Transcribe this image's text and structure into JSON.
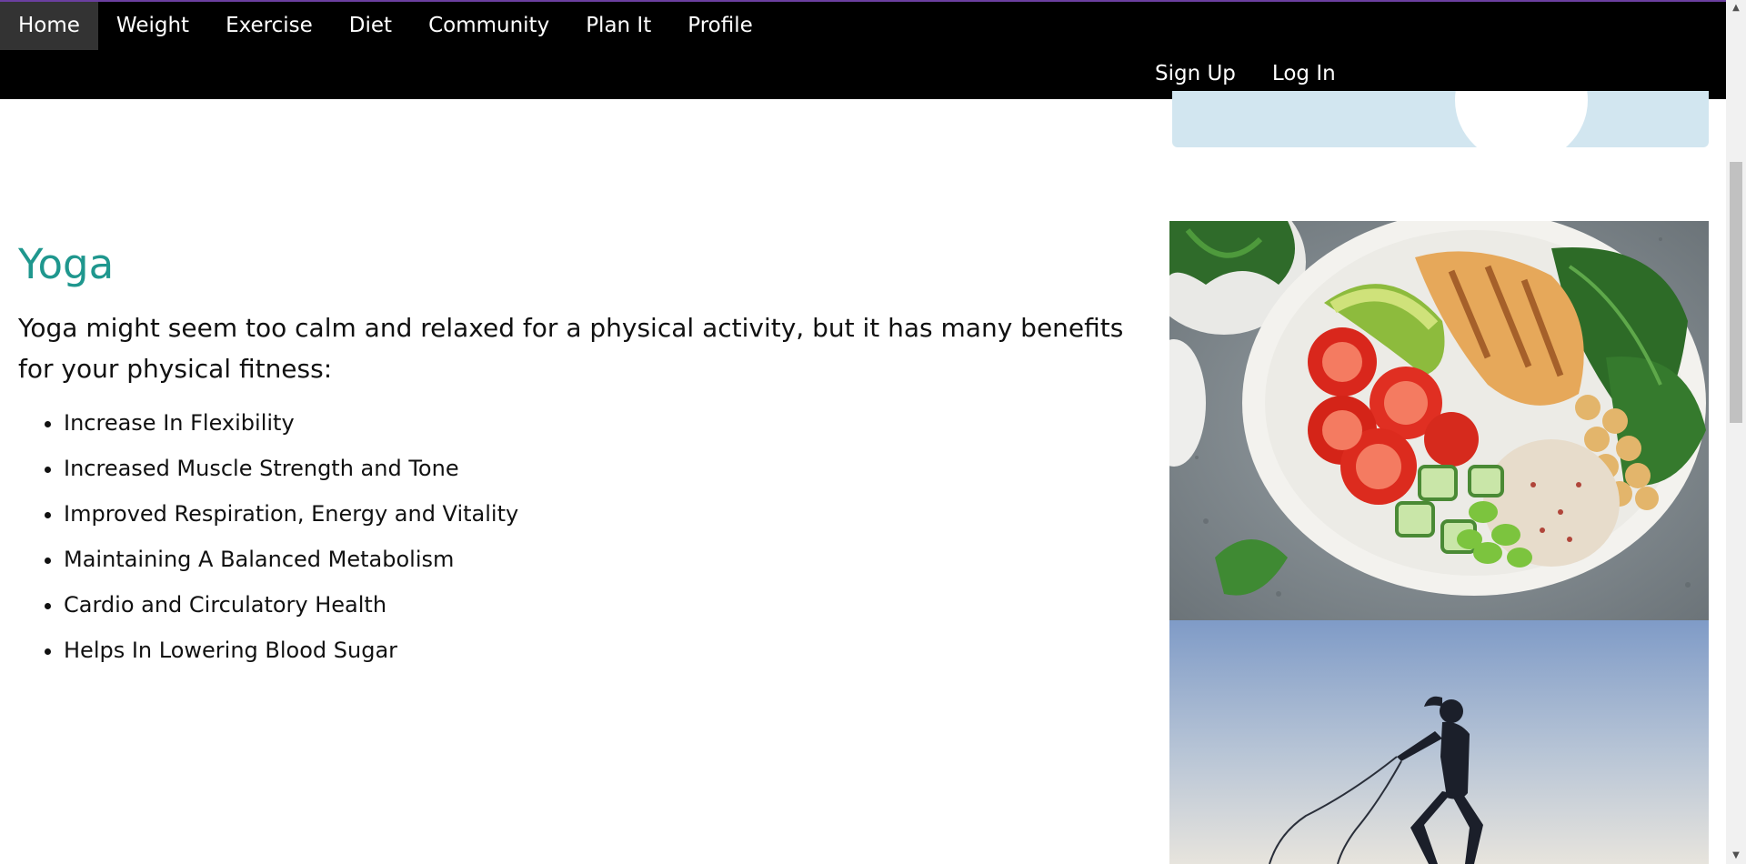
{
  "nav": {
    "left_items": [
      {
        "label": "Home",
        "active": true
      },
      {
        "label": "Weight",
        "active": false
      },
      {
        "label": "Exercise",
        "active": false
      },
      {
        "label": "Diet",
        "active": false
      },
      {
        "label": "Community",
        "active": false
      },
      {
        "label": "Plan It",
        "active": false
      },
      {
        "label": "Profile",
        "active": false
      }
    ],
    "right_items": [
      {
        "label": "Sign Up"
      },
      {
        "label": "Log In"
      }
    ]
  },
  "yoga": {
    "title": "Yoga",
    "intro": "Yoga might seem too calm and relaxed for a physical activity, but it has many benefits for your physical fitness:",
    "benefits": [
      "Increase In Flexibility",
      "Increased Muscle Strength and Tone",
      "Improved Respiration, Energy and Vitality",
      "Maintaining A Balanced Metabolism",
      "Cardio and Circulatory Health",
      "Helps In Lowering Blood Sugar"
    ]
  },
  "colors": {
    "navbar_bg": "#000000",
    "active_nav_bg": "#333333",
    "title_teal": "#1f978e",
    "card_blue": "#d2e6f0"
  },
  "images": {
    "salad": "salad-bowl-photo",
    "jump": "jump-rope-silhouette-photo"
  }
}
